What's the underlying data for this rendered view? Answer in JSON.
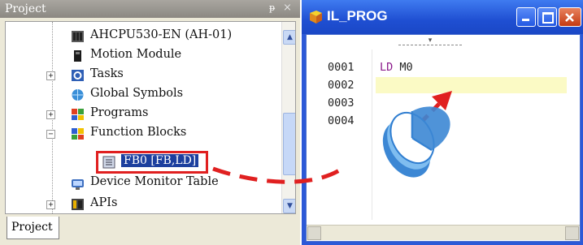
{
  "project_panel": {
    "title": "Project",
    "pin_symbol": "ᵽ",
    "close_symbol": "×",
    "tab_label": "Project",
    "tree": [
      {
        "label": "AHCPU530-EN (AH-01)",
        "icon": "cpu-icon"
      },
      {
        "label": "Motion Module",
        "icon": "module-icon"
      },
      {
        "label": "Tasks",
        "icon": "tasks-icon",
        "expander": "+"
      },
      {
        "label": "Global Symbols",
        "icon": "globe-icon"
      },
      {
        "label": "Programs",
        "icon": "programs-icon",
        "expander": "+"
      },
      {
        "label": "Function Blocks",
        "icon": "function-blocks-icon",
        "expander": "−"
      },
      {
        "label": "FB0 [FB,LD]",
        "icon": "fb-icon",
        "selected": true
      },
      {
        "label": "Device Monitor Table",
        "icon": "monitor-icon"
      },
      {
        "label": "APIs",
        "icon": "api-icon",
        "expander": "+"
      }
    ],
    "colors": {
      "selection_border": "#e02020",
      "selection_fill": "#1c3f9e"
    }
  },
  "editor_window": {
    "title": "IL_PROG",
    "line_numbers": [
      "0001",
      "0002",
      "0003",
      "0004"
    ],
    "code_line_1": {
      "op": "LD",
      "operand": "M0"
    },
    "colors": {
      "titlebar": "#2c59d7",
      "highlight_line": "#fbfac5",
      "op_color": "#8b1a8b"
    }
  },
  "annotation": {
    "arrow_color": "#e02020",
    "cursor": "double-click-mouse-icon"
  }
}
